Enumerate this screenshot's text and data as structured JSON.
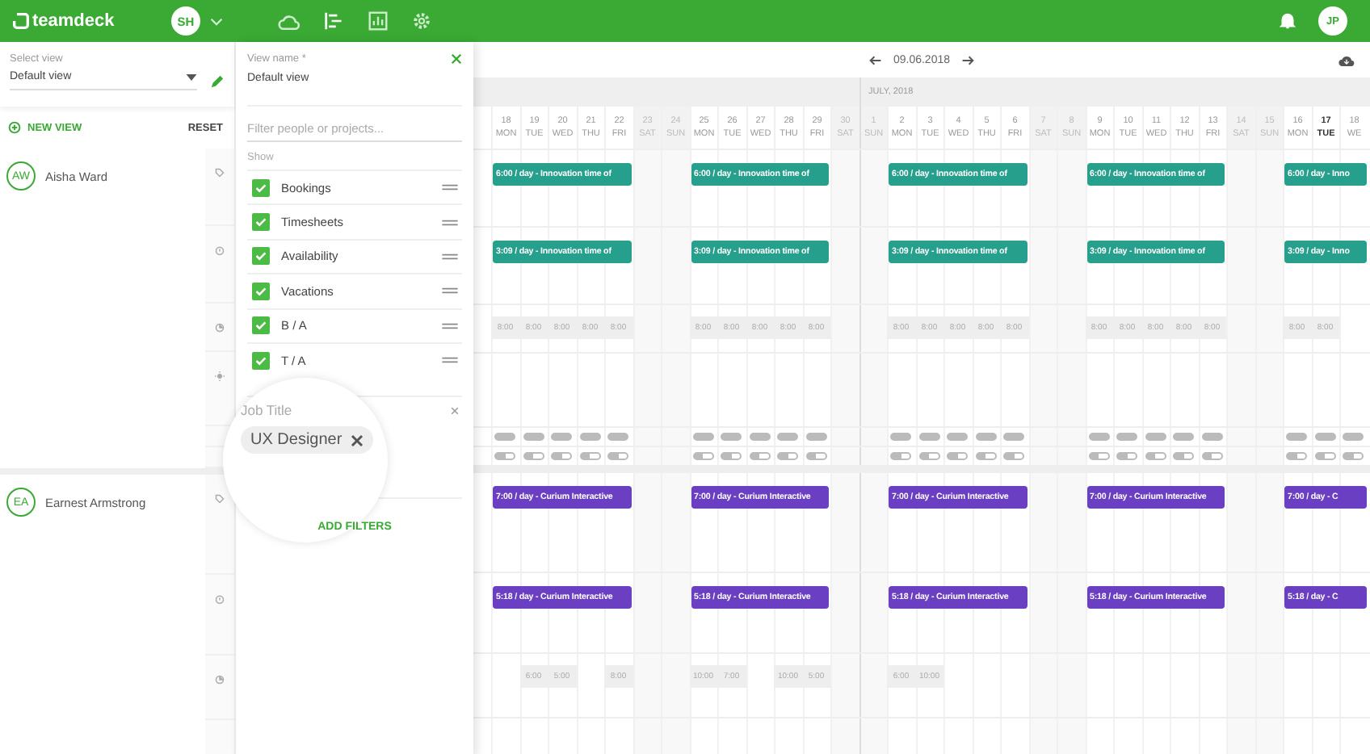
{
  "header": {
    "logo": "teamdeck",
    "user_initials": "SH",
    "profile_initials": "JP"
  },
  "view_select": {
    "label": "Select view",
    "value": "Default view"
  },
  "new_view": "NEW VIEW",
  "reset": "RESET",
  "filter_panel": {
    "name_label": "View name *",
    "name_value": "Default view",
    "search_placeholder": "Filter people or projects...",
    "show_label": "Show",
    "items": [
      {
        "label": "Bookings",
        "checked": true
      },
      {
        "label": "Timesheets",
        "checked": true
      },
      {
        "label": "Availability",
        "checked": true
      },
      {
        "label": "Vacations",
        "checked": true
      },
      {
        "label": "B / A",
        "checked": true
      },
      {
        "label": "T / A",
        "checked": true
      }
    ],
    "filter_label": "Job Title",
    "filter_chip": "UX Designer",
    "add_filters": "ADD FILTERS"
  },
  "calendar": {
    "date": "09.06.2018",
    "month_label": "JULY, 2018",
    "days": [
      {
        "num": "18",
        "dow": "MON",
        "weekend": false,
        "today": false,
        "month_start": false
      },
      {
        "num": "19",
        "dow": "TUE",
        "weekend": false,
        "today": false,
        "month_start": false
      },
      {
        "num": "20",
        "dow": "WED",
        "weekend": false,
        "today": false,
        "month_start": false
      },
      {
        "num": "21",
        "dow": "THU",
        "weekend": false,
        "today": false,
        "month_start": false
      },
      {
        "num": "22",
        "dow": "FRI",
        "weekend": false,
        "today": false,
        "month_start": false
      },
      {
        "num": "23",
        "dow": "SAT",
        "weekend": true,
        "today": false,
        "month_start": false
      },
      {
        "num": "24",
        "dow": "SUN",
        "weekend": true,
        "today": false,
        "month_start": false
      },
      {
        "num": "25",
        "dow": "MON",
        "weekend": false,
        "today": false,
        "month_start": false
      },
      {
        "num": "26",
        "dow": "TUE",
        "weekend": false,
        "today": false,
        "month_start": false
      },
      {
        "num": "27",
        "dow": "WED",
        "weekend": false,
        "today": false,
        "month_start": false
      },
      {
        "num": "28",
        "dow": "THU",
        "weekend": false,
        "today": false,
        "month_start": false
      },
      {
        "num": "29",
        "dow": "FRI",
        "weekend": false,
        "today": false,
        "month_start": false
      },
      {
        "num": "30",
        "dow": "SAT",
        "weekend": true,
        "today": false,
        "month_start": false
      },
      {
        "num": "1",
        "dow": "SUN",
        "weekend": true,
        "today": false,
        "month_start": true
      },
      {
        "num": "2",
        "dow": "MON",
        "weekend": false,
        "today": false,
        "month_start": false
      },
      {
        "num": "3",
        "dow": "TUE",
        "weekend": false,
        "today": false,
        "month_start": false
      },
      {
        "num": "4",
        "dow": "WED",
        "weekend": false,
        "today": false,
        "month_start": false
      },
      {
        "num": "5",
        "dow": "THU",
        "weekend": false,
        "today": false,
        "month_start": false
      },
      {
        "num": "6",
        "dow": "FRI",
        "weekend": false,
        "today": false,
        "month_start": false
      },
      {
        "num": "7",
        "dow": "SAT",
        "weekend": true,
        "today": false,
        "month_start": false
      },
      {
        "num": "8",
        "dow": "SUN",
        "weekend": true,
        "today": false,
        "month_start": false
      },
      {
        "num": "9",
        "dow": "MON",
        "weekend": false,
        "today": false,
        "month_start": false
      },
      {
        "num": "10",
        "dow": "TUE",
        "weekend": false,
        "today": false,
        "month_start": false
      },
      {
        "num": "11",
        "dow": "WED",
        "weekend": false,
        "today": false,
        "month_start": false
      },
      {
        "num": "12",
        "dow": "THU",
        "weekend": false,
        "today": false,
        "month_start": false
      },
      {
        "num": "13",
        "dow": "FRI",
        "weekend": false,
        "today": false,
        "month_start": false
      },
      {
        "num": "14",
        "dow": "SAT",
        "weekend": true,
        "today": false,
        "month_start": false
      },
      {
        "num": "15",
        "dow": "SUN",
        "weekend": true,
        "today": false,
        "month_start": false
      },
      {
        "num": "16",
        "dow": "MON",
        "weekend": false,
        "today": false,
        "month_start": false
      },
      {
        "num": "17",
        "dow": "TUE",
        "weekend": false,
        "today": true,
        "month_start": false
      },
      {
        "num": "18",
        "dow": "WE",
        "weekend": false,
        "today": false,
        "month_start": false
      }
    ]
  },
  "people": [
    {
      "initials": "AW",
      "name": "Aisha Ward",
      "color": "#26a08c",
      "rows": [
        {
          "kind": "booking",
          "bars": [
            "6:00 / day - Innovation time of",
            "6:00 / day - Innovation time of",
            "6:00 / day - Innovation time of",
            "6:00 / day - Innovation time of",
            "6:00 / day - Inno"
          ]
        },
        {
          "kind": "timesheet",
          "bars": [
            "3:09 / day - Innovation time of",
            "3:09 / day - Innovation time of",
            "3:09 / day - Innovation time of",
            "3:09 / day - Innovation time of",
            "3:09 / day - Inno"
          ]
        },
        {
          "kind": "availability",
          "cells": [
            {
              "text": "8:00"
            },
            {
              "text": "8:00"
            },
            {
              "text": "8:00"
            },
            {
              "text": "8:00"
            },
            {
              "text": "8:00"
            },
            {
              "text": "8:00"
            },
            {
              "text": "8:00"
            },
            {
              "text": "8:00"
            },
            {
              "text": "8:00"
            },
            {
              "text": "8:00"
            },
            {
              "text": "8:00"
            },
            {
              "text": "8:00"
            },
            {
              "text": "8:00"
            },
            {
              "text": "8:00"
            },
            {
              "text": "8:00"
            },
            {
              "text": "8:00"
            },
            {
              "text": "8:00"
            },
            {
              "text": "8:00"
            },
            {
              "text": "8:00"
            },
            {
              "text": "8:00"
            },
            {
              "text": "8:00"
            },
            {
              "text": "8:00"
            }
          ]
        },
        {
          "kind": "vacations"
        },
        {
          "kind": "toggle",
          "on": true
        },
        {
          "kind": "toggle",
          "on": false
        }
      ]
    },
    {
      "initials": "EA",
      "name": "Earnest Armstrong",
      "color": "#6a3fc1",
      "rows": [
        {
          "kind": "booking",
          "bars": [
            "7:00 / day - Curium Interactive",
            "7:00 / day - Curium Interactive",
            "7:00 / day - Curium Interactive",
            "7:00 / day - Curium Interactive",
            "7:00 / day - C"
          ]
        },
        {
          "kind": "timesheet",
          "bars": [
            "5:18 / day - Curium Interactive",
            "5:18 / day - Curium Interactive",
            "5:18 / day - Curium Interactive",
            "5:18 / day - Curium Interactive",
            "5:18 / day - C"
          ]
        },
        {
          "kind": "availability",
          "cells": [
            {},
            {
              "text": "6:00"
            },
            {
              "text": "5:00"
            },
            {},
            {
              "text": "8:00"
            },
            {
              "text": "10:00"
            },
            {
              "text": "7:00"
            },
            {},
            {
              "text": "10:00"
            },
            {
              "text": "5:00"
            },
            {
              "text": "6:00"
            },
            {
              "text": "10:00"
            }
          ]
        },
        {
          "kind": "more"
        }
      ]
    }
  ]
}
